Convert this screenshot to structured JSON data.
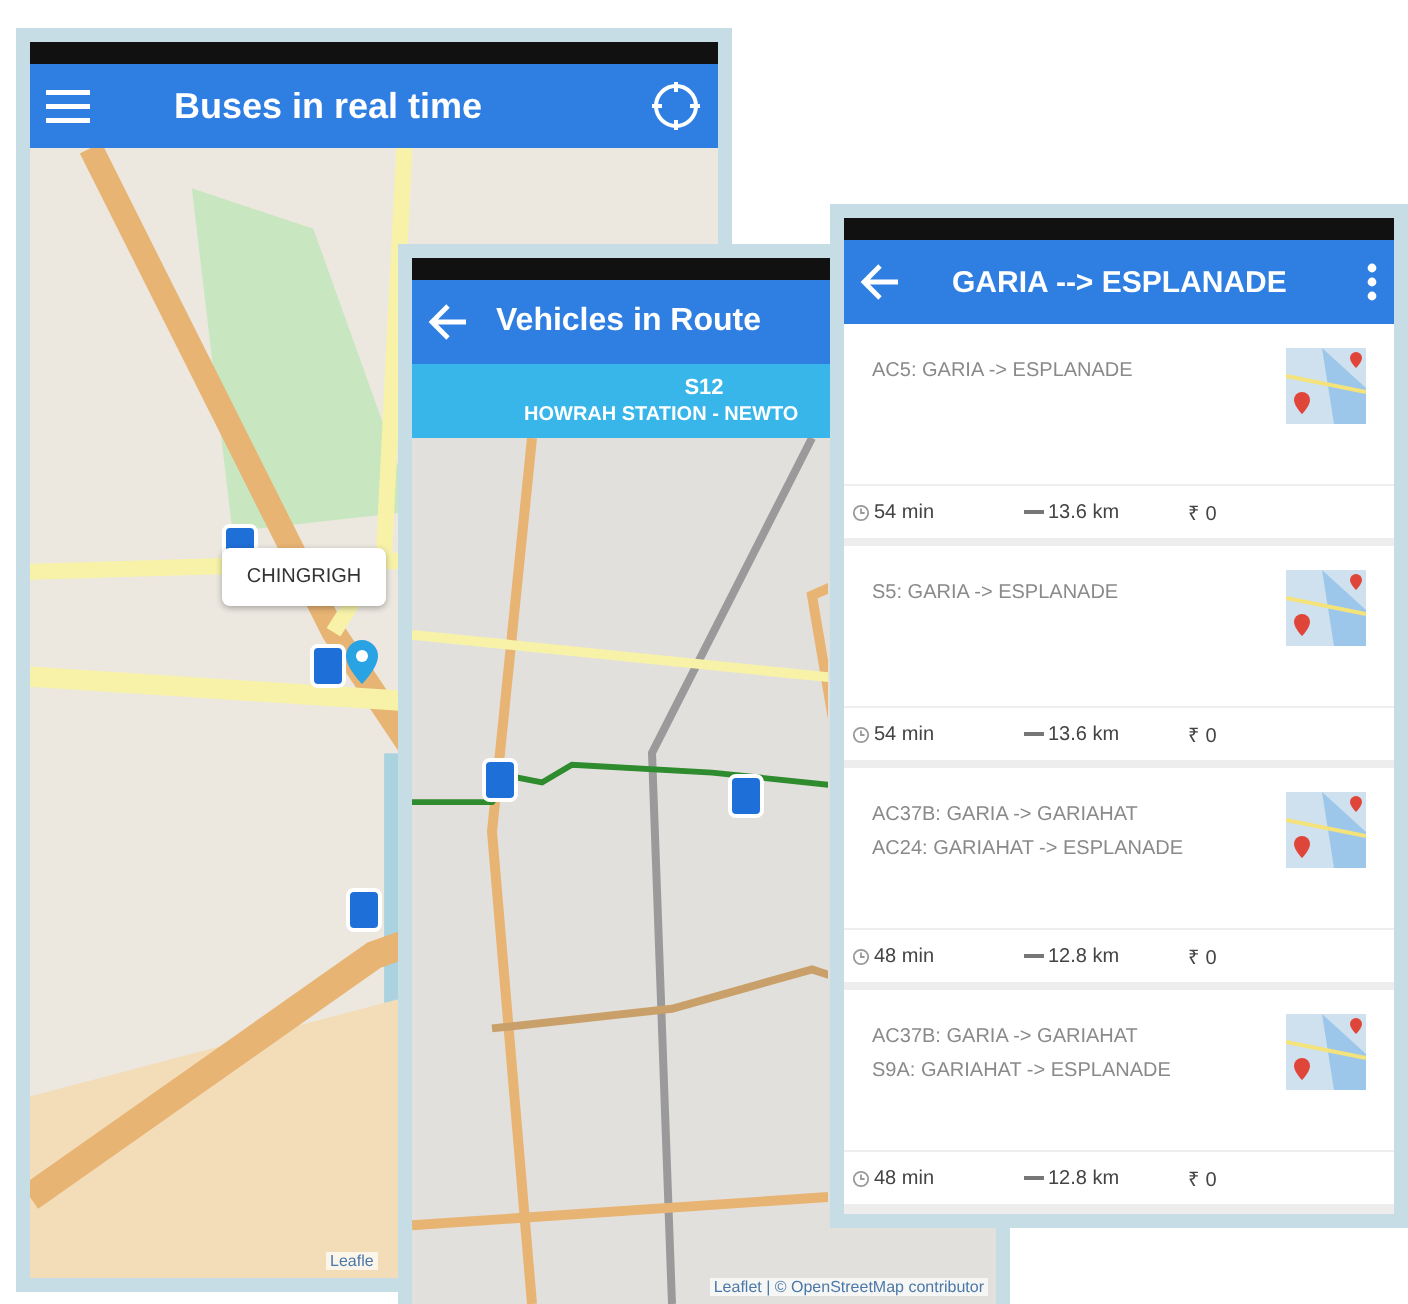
{
  "live_map": {
    "title": "Buses in real time",
    "popup": "CHINGRIGH",
    "attribution": "Leafle"
  },
  "route_map": {
    "title": "Vehicles in Route",
    "route_number": "S12",
    "route_name": "HOWRAH STATION - NEWTO",
    "attribution": "Leaflet | © OpenStreetMap contributor"
  },
  "journeys": {
    "title": "GARIA --> ESPLANADE",
    "options": [
      {
        "legs": [
          "AC5: GARIA -> ESPLANADE"
        ],
        "time": "54 min",
        "distance": "13.6 km",
        "fare": "₹ 0"
      },
      {
        "legs": [
          "S5: GARIA -> ESPLANADE"
        ],
        "time": "54 min",
        "distance": "13.6 km",
        "fare": "₹ 0"
      },
      {
        "legs": [
          "AC37B: GARIA -> GARIAHAT",
          "AC24: GARIAHAT -> ESPLANADE"
        ],
        "time": "48 min",
        "distance": "12.8 km",
        "fare": "₹ 0"
      },
      {
        "legs": [
          "AC37B: GARIA -> GARIAHAT",
          "S9A: GARIAHAT -> ESPLANADE"
        ],
        "time": "48 min",
        "distance": "12.8 km",
        "fare": "₹ 0"
      }
    ]
  }
}
